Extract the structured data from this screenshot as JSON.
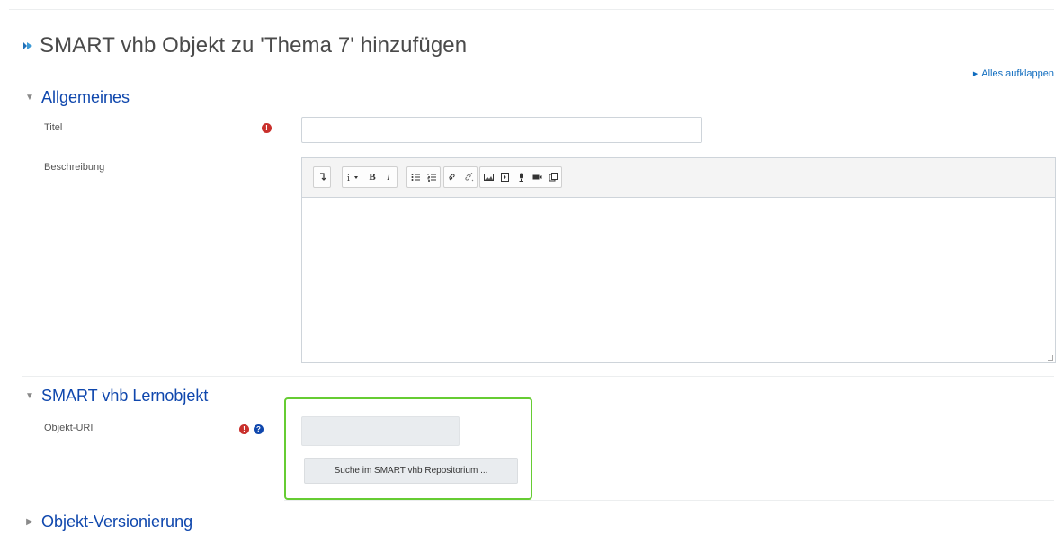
{
  "page": {
    "title": "SMART vhb Objekt zu 'Thema 7' hinzufügen",
    "expand_all": "Alles aufklappen"
  },
  "sections": {
    "general": {
      "header": "Allgemeines",
      "title_label": "Titel",
      "title_value": "",
      "description_label": "Beschreibung",
      "description_value": ""
    },
    "learning_object": {
      "header": "SMART vhb Lernobjekt",
      "uri_label": "Objekt-URI",
      "uri_value": "",
      "search_button": "Suche im SMART vhb Repositorium ..."
    },
    "versioning": {
      "header": "Objekt-Versionierung"
    }
  },
  "editor_toolbar": {
    "icons": [
      "show-more-icon",
      "paragraph-style-icon",
      "bold-icon",
      "italic-icon",
      "unordered-list-icon",
      "ordered-list-icon",
      "link-icon",
      "unlink-icon",
      "image-icon",
      "media-icon",
      "record-audio-icon",
      "record-video-icon",
      "manage-files-icon"
    ],
    "bold_glyph": "B",
    "italic_glyph": "I"
  },
  "colors": {
    "link": "#0f47ad",
    "required": "#c9302c",
    "highlight": "#66cc33"
  }
}
